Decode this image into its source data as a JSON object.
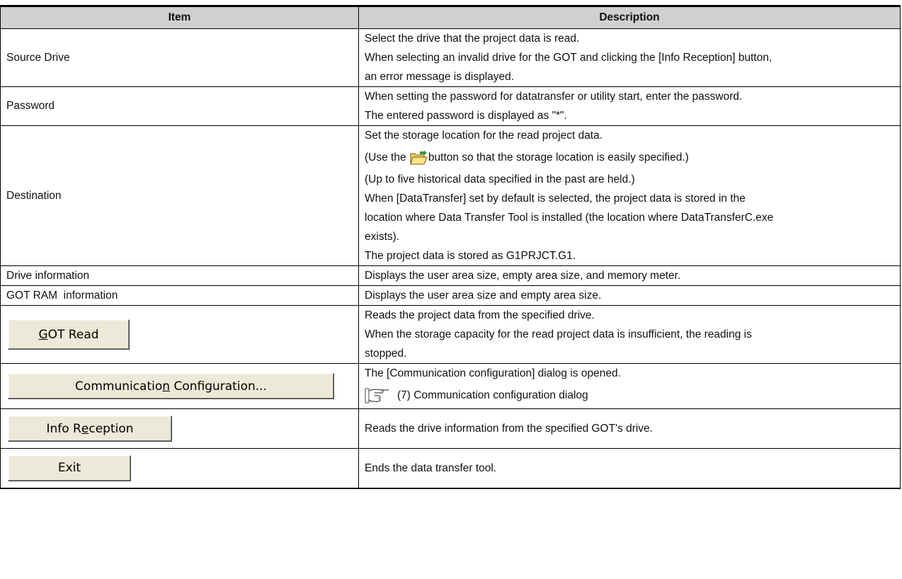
{
  "header": {
    "item": "Item",
    "description": "Description"
  },
  "rows": [
    {
      "item": "Source Drive",
      "lines": [
        "Select the drive that the project data is read.",
        "When selecting an invalid drive for the GOT and clicking the [Info Reception] button,",
        "an error message is displayed."
      ]
    },
    {
      "item": "Password",
      "lines": [
        "When setting the password for datatransfer or utility start, enter the password.",
        "The entered password is displayed as \"*\"."
      ]
    },
    {
      "item": "Destination",
      "lines": [
        "Set the storage location for the read project data.",
        "(Up to five historical data specified in the past are held.)",
        "When [DataTransfer] set by default is selected, the project data is stored in the",
        "location where Data Transfer Tool is installed (the location where DataTransferC.exe",
        "exists).",
        "The project data is stored as G1PRJCT.G1."
      ],
      "folder_line_before": "(Use the ",
      "folder_line_after": "button so that the storage location is easily specified.)",
      "folder_icon": "folder-open-icon"
    },
    {
      "item": "Drive information",
      "lines": [
        "Displays the user area size, empty area size, and memory meter."
      ]
    },
    {
      "item": "GOT RAM  information",
      "lines": [
        "Displays the user area size and empty area size."
      ]
    },
    {
      "button": {
        "pre": "",
        "key": "G",
        "post": "OT Read"
      },
      "lines": [
        "Reads the project data from the specified drive.",
        "When the storage capacity for the read project data is insufficient, the reading is",
        "stopped."
      ]
    },
    {
      "button": {
        "pre": "Communicatio",
        "key": "n",
        "post": " Configuration..."
      },
      "lines": [
        "The [Communication configuration] dialog is opened."
      ],
      "reference": "(7) Communication configuration dialog",
      "reference_icon": "pointing-hand-icon"
    },
    {
      "button": {
        "pre": "Info R",
        "key": "e",
        "post": "ception"
      },
      "lines": [
        "Reads the drive information from the specified GOT's drive."
      ]
    },
    {
      "button": {
        "pre": "Exit",
        "key": "",
        "post": ""
      },
      "lines": [
        "Ends the data transfer tool."
      ]
    }
  ]
}
